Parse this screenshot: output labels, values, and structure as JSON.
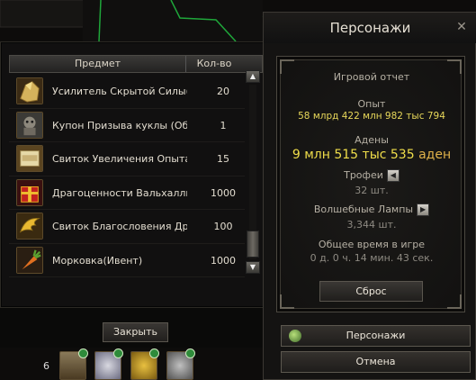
{
  "items_window": {
    "col_item": "Предмет",
    "col_qty": "Кол-во",
    "rows": [
      {
        "name": "Усилитель Скрытой Силы(Заг",
        "qty": "20",
        "icon": "gold-ore-icon"
      },
      {
        "name": "Купон Призыва куклы (Обычн",
        "qty": "1",
        "icon": "doll-coupon-icon"
      },
      {
        "name": "Свиток Увеличения Опыта(За",
        "qty": "15",
        "icon": "exp-scroll-icon"
      },
      {
        "name": "Драгоценности Вальхаллы №",
        "qty": "1000",
        "icon": "red-gem-box-icon"
      },
      {
        "name": "Свиток Благословения Драко",
        "qty": "100",
        "icon": "golden-wing-icon"
      },
      {
        "name": "Морковка(Ивент)",
        "qty": "1000",
        "icon": "carrot-icon"
      }
    ],
    "close_label": "Закрыть"
  },
  "char_window": {
    "title": "Персонажи",
    "report_title": "Игровой отчет",
    "exp_label": "Опыт",
    "exp_value": "58 млрд 422 млн 982 тыс 794",
    "adena_label": "Адены",
    "adena_value": "9 млн 515 тыс 535",
    "adena_unit": "аден",
    "trophies_label": "Трофеи",
    "trophies_value": "32 шт.",
    "lamps_label": "Волшебные Лампы",
    "lamps_value": "3,344 шт.",
    "time_label": "Общее время в игре",
    "time_value": "0 д. 0 ч. 14 мин. 43 сек.",
    "reset_label": "Сброс",
    "chars_button": "Персонажи",
    "cancel_button": "Отмена"
  },
  "hotbar": {
    "page_number": "6"
  },
  "colors": {
    "gold_text": "#e8d85a",
    "window_bg": "#141312",
    "border": "#4b4840"
  }
}
